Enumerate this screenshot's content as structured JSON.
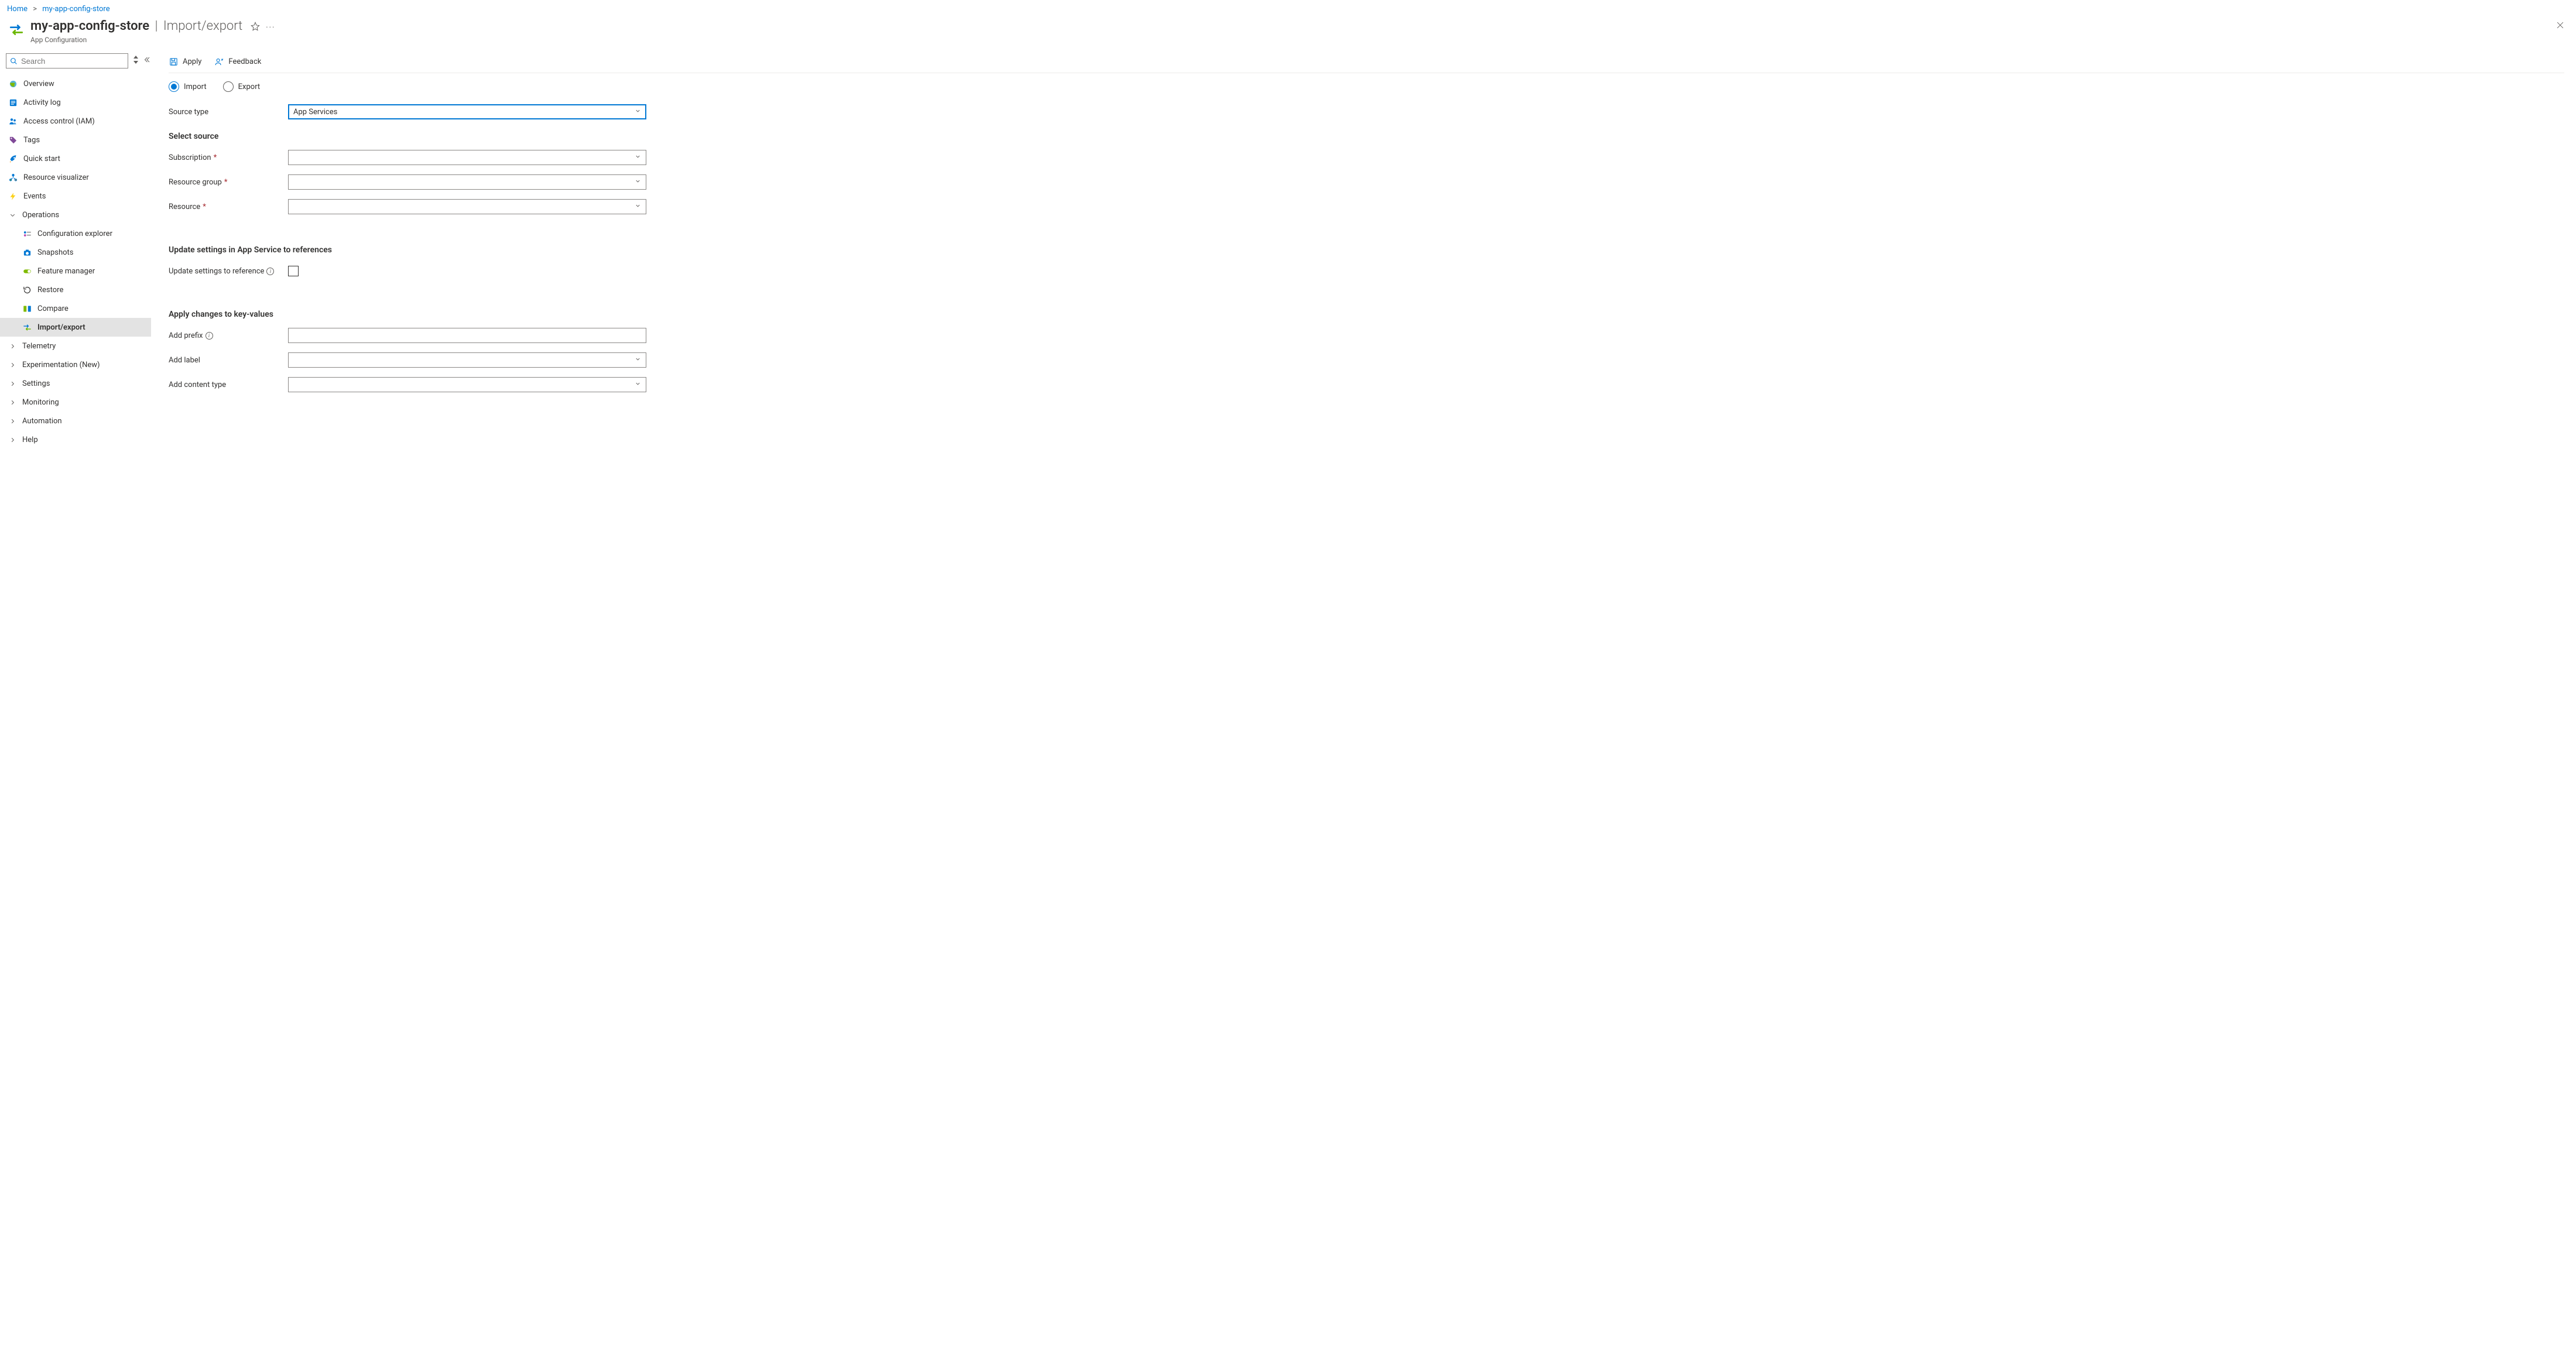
{
  "breadcrumb": {
    "home": "Home",
    "current": "my-app-config-store"
  },
  "header": {
    "resource_name": "my-app-config-store",
    "page_name": "Import/export",
    "subtitle": "App Configuration"
  },
  "sidebar": {
    "search_placeholder": "Search",
    "items": [
      {
        "label": "Overview",
        "icon": "globe",
        "kind": "item"
      },
      {
        "label": "Activity log",
        "icon": "log",
        "kind": "item"
      },
      {
        "label": "Access control (IAM)",
        "icon": "iam",
        "kind": "item"
      },
      {
        "label": "Tags",
        "icon": "tag",
        "kind": "item"
      },
      {
        "label": "Quick start",
        "icon": "quickstart",
        "kind": "item"
      },
      {
        "label": "Resource visualizer",
        "icon": "visualizer",
        "kind": "item"
      },
      {
        "label": "Events",
        "icon": "events",
        "kind": "item"
      },
      {
        "label": "Operations",
        "icon": "chevron-down",
        "kind": "group-open"
      },
      {
        "label": "Configuration explorer",
        "icon": "config-explorer",
        "kind": "child"
      },
      {
        "label": "Snapshots",
        "icon": "snapshots",
        "kind": "child"
      },
      {
        "label": "Feature manager",
        "icon": "feature-manager",
        "kind": "child"
      },
      {
        "label": "Restore",
        "icon": "restore",
        "kind": "child"
      },
      {
        "label": "Compare",
        "icon": "compare",
        "kind": "child"
      },
      {
        "label": "Import/export",
        "icon": "import-export",
        "kind": "child",
        "selected": true
      },
      {
        "label": "Telemetry",
        "icon": "chevron-right",
        "kind": "group"
      },
      {
        "label": "Experimentation (New)",
        "icon": "chevron-right",
        "kind": "group"
      },
      {
        "label": "Settings",
        "icon": "chevron-right",
        "kind": "group"
      },
      {
        "label": "Monitoring",
        "icon": "chevron-right",
        "kind": "group"
      },
      {
        "label": "Automation",
        "icon": "chevron-right",
        "kind": "group"
      },
      {
        "label": "Help",
        "icon": "chevron-right",
        "kind": "group"
      }
    ]
  },
  "toolbar": {
    "apply": "Apply",
    "feedback": "Feedback"
  },
  "form": {
    "radio_import": "Import",
    "radio_export": "Export",
    "radio_selected": "import",
    "source_type_label": "Source type",
    "source_type_value": "App Services",
    "section_select_source": "Select source",
    "subscription_label": "Subscription",
    "subscription_value": "",
    "resource_group_label": "Resource group",
    "resource_group_value": "",
    "resource_label": "Resource",
    "resource_value": "",
    "section_update": "Update settings in App Service to references",
    "update_ref_label": "Update settings to reference",
    "update_ref_checked": false,
    "section_apply_changes": "Apply changes to key-values",
    "add_prefix_label": "Add prefix",
    "add_prefix_value": "",
    "add_label_label": "Add label",
    "add_label_value": "",
    "add_content_type_label": "Add content type",
    "add_content_type_value": ""
  }
}
